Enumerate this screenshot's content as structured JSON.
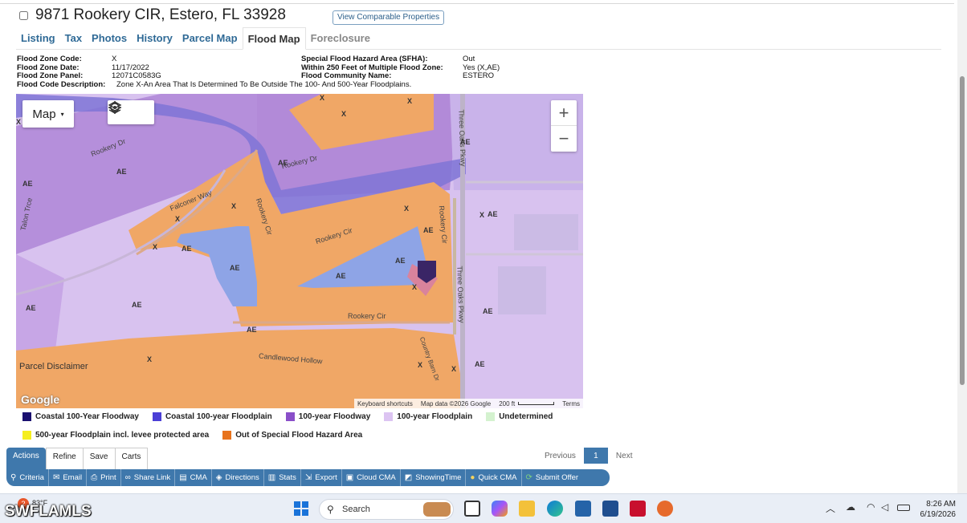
{
  "listing": {
    "address": "9871 Rookery CIR, Estero, FL 33928",
    "compare_button": "View Comparable Properties"
  },
  "tabs": [
    "Listing",
    "Tax",
    "Photos",
    "History",
    "Parcel Map",
    "Flood Map",
    "Foreclosure"
  ],
  "active_tab": "Flood Map",
  "flood_info": {
    "zone_code_label": "Flood Zone Code:",
    "zone_code": "X",
    "zone_date_label": "Flood Zone Date:",
    "zone_date": "11/17/2022",
    "zone_panel_label": "Flood Zone Panel:",
    "zone_panel": "12071C0583G",
    "desc_label": "Flood Code Description:",
    "desc": "Zone X-An Area That Is Determined To Be Outside The 100- And 500-Year Floodplains.",
    "sfha_label": "Special Flood Hazard Area (SFHA):",
    "sfha": "Out",
    "within250_label": "Within 250 Feet of Multiple Flood Zone:",
    "within250": "Yes (X,AE)",
    "community_label": "Flood Community Name:",
    "community": "ESTERO"
  },
  "map": {
    "type_button": "Map",
    "zoom_in": "+",
    "zoom_out": "−",
    "parcel_disclaimer": "Parcel Disclaimer",
    "google": "Google",
    "keyboard_shortcuts": "Keyboard shortcuts",
    "map_data": "Map data ©2026 Google",
    "scale": "200 ft",
    "terms": "Terms",
    "street_labels": [
      "Rookery Dr",
      "Rookery Dr",
      "Falconer Way",
      "Rookery Cir",
      "Rookery Cir",
      "Rookery Cir",
      "Rookery Cir",
      "Talon Trce",
      "Three Oaks Pkwy",
      "Three Oaks Pkwy",
      "Candlewood Hollow",
      "Country Barn Dr"
    ],
    "zone_labels": [
      "X",
      "X",
      "X",
      "X",
      "X",
      "X",
      "X",
      "X",
      "X",
      "X",
      "X",
      "X",
      "X",
      "AE",
      "AE",
      "AE",
      "AE",
      "AE",
      "AE",
      "AE",
      "AE",
      "AE",
      "AE",
      "AE",
      "AE",
      "AE",
      "AE",
      "AE",
      "AE",
      "AE"
    ]
  },
  "legend": [
    {
      "label": "Coastal 100-Year Floodway",
      "color": "#1a1070"
    },
    {
      "label": "Coastal 100-year Floodplain",
      "color": "#4b3fd6"
    },
    {
      "label": "100-year Floodway",
      "color": "#8a4fc9"
    },
    {
      "label": "100-year Floodplain",
      "color": "#dcc4f2"
    },
    {
      "label": "Undetermined",
      "color": "#d4f2cf"
    },
    {
      "label": "500-year Floodplain incl. levee protected area",
      "color": "#f5ee1e"
    },
    {
      "label": "Out of Special Flood Hazard Area",
      "color": "#e8731c"
    }
  ],
  "actions": {
    "tabs": [
      "Actions",
      "Refine",
      "Save",
      "Carts"
    ],
    "buttons": [
      {
        "label": "Criteria",
        "icon": "search-icon"
      },
      {
        "label": "Email",
        "icon": "email-icon"
      },
      {
        "label": "Print",
        "icon": "print-icon"
      },
      {
        "label": "Share Link",
        "icon": "link-icon"
      },
      {
        "label": "CMA",
        "icon": "cma-icon"
      },
      {
        "label": "Directions",
        "icon": "directions-icon"
      },
      {
        "label": "Stats",
        "icon": "stats-icon"
      },
      {
        "label": "Export",
        "icon": "export-icon"
      },
      {
        "label": "Cloud CMA",
        "icon": "cloud-cma-icon"
      },
      {
        "label": "ShowingTime",
        "icon": "showingtime-icon"
      },
      {
        "label": "Quick CMA",
        "icon": "quick-cma-icon"
      },
      {
        "label": "Submit Offer",
        "icon": "submit-offer-icon"
      }
    ]
  },
  "pager": {
    "previous": "Previous",
    "current": "1",
    "next": "Next"
  },
  "taskbar": {
    "weather_badge": "2",
    "temperature": "83°F",
    "search_placeholder": "Search",
    "time": "8:26 AM",
    "date": "6/19/2026"
  },
  "watermark": "SWFLAMLS"
}
